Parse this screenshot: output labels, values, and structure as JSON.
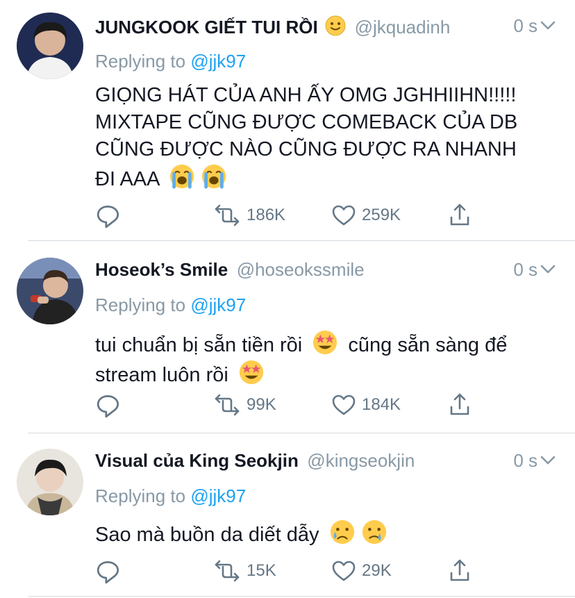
{
  "tweets": [
    {
      "name": "JUNGKOOK GIẾT TUI RỒI",
      "name_emoji": "slightly-smiling-face",
      "handle": "@jkquadinh",
      "time": "0 s",
      "replying_prefix": "Replying to",
      "replying_to": "@jjk97",
      "body_lines": [
        "GIỌNG HÁT CỦA ANH ẤY OMG JGHHIIHN!!!!!",
        "MIXTAPE CŨNG ĐƯỢC COMEBACK CỦA DB",
        "CŨNG ĐƯỢC NÀO CŨNG ĐƯỢC RA NHANH",
        "ĐI AAA"
      ],
      "retweets": "186K",
      "likes": "259K"
    },
    {
      "name": "Hoseok’s Smile",
      "handle": "@hoseokssmile",
      "time": "0 s",
      "replying_prefix": "Replying to",
      "replying_to": "@jjk97",
      "body_lines": [
        "tui chuẩn bị sẵn tiền rồi",
        "cũng sẵn sàng để",
        "stream luôn rồi"
      ],
      "retweets": "99K",
      "likes": "184K"
    },
    {
      "name": "Visual của King Seokjin",
      "handle": "@kingseokjin",
      "time": "0 s",
      "replying_prefix": "Replying to",
      "replying_to": "@jjk97",
      "body_lines": [
        "Sao mà buồn da diết dẫy"
      ],
      "retweets": "15K",
      "likes": "29K"
    }
  ],
  "colors": {
    "link": "#1da1f2",
    "muted": "#8899a6",
    "icon": "#657786",
    "emoji": "#ffcc4d"
  }
}
